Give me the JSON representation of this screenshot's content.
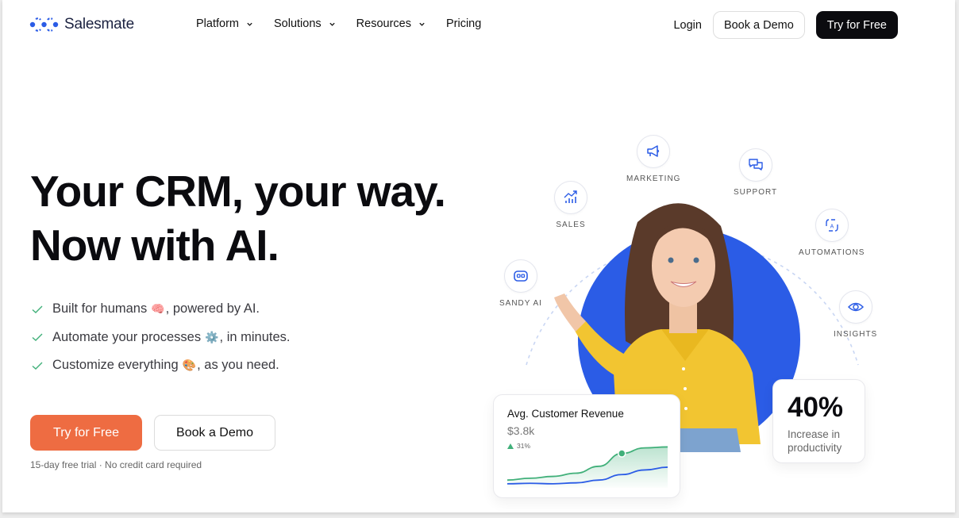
{
  "brand": {
    "name": "Salesmate",
    "accent": "#2b5ce6",
    "cta_color": "#ee6c42"
  },
  "nav": {
    "items": [
      {
        "label": "Platform",
        "has_dropdown": true
      },
      {
        "label": "Solutions",
        "has_dropdown": true
      },
      {
        "label": "Resources",
        "has_dropdown": true
      },
      {
        "label": "Pricing",
        "has_dropdown": false
      }
    ],
    "login": "Login",
    "book_demo": "Book a Demo",
    "try_free": "Try for Free"
  },
  "hero": {
    "title_line1": "Your CRM, your way.",
    "title_line2": "Now with AI.",
    "features": [
      {
        "before": "Built for humans",
        "emoji": "🧠",
        "after": ", powered by AI."
      },
      {
        "before": "Automate your processes",
        "emoji": "⚙️",
        "after": ", in minutes."
      },
      {
        "before": "Customize everything",
        "emoji": "🎨",
        "after": ", as you need."
      }
    ],
    "primary_cta": "Try for Free",
    "secondary_cta": "Book a Demo",
    "note": "15-day free trial · No credit card required"
  },
  "orbit_nodes": [
    {
      "label": "SANDY AI",
      "icon": "robot-icon"
    },
    {
      "label": "SALES",
      "icon": "chart-trend-icon"
    },
    {
      "label": "MARKETING",
      "icon": "megaphone-icon"
    },
    {
      "label": "SUPPORT",
      "icon": "chat-bubbles-icon"
    },
    {
      "label": "AUTOMATIONS",
      "icon": "automation-cycle-icon"
    },
    {
      "label": "INSIGHTS",
      "icon": "eye-icon"
    }
  ],
  "revenue_card": {
    "title": "Avg. Customer Revenue",
    "value": "$3.8k",
    "delta": "31%",
    "series": [
      {
        "name": "green",
        "color": "#41b07a",
        "values": [
          0.1,
          0.14,
          0.18,
          0.25,
          0.4,
          0.68,
          0.8,
          0.82
        ]
      },
      {
        "name": "blue",
        "color": "#2b5ce6",
        "values": [
          0.02,
          0.03,
          0.02,
          0.04,
          0.1,
          0.22,
          0.32,
          0.38
        ]
      }
    ],
    "highlight_index": 5
  },
  "stat_card": {
    "value": "40%",
    "label": "Increase in productivity"
  }
}
